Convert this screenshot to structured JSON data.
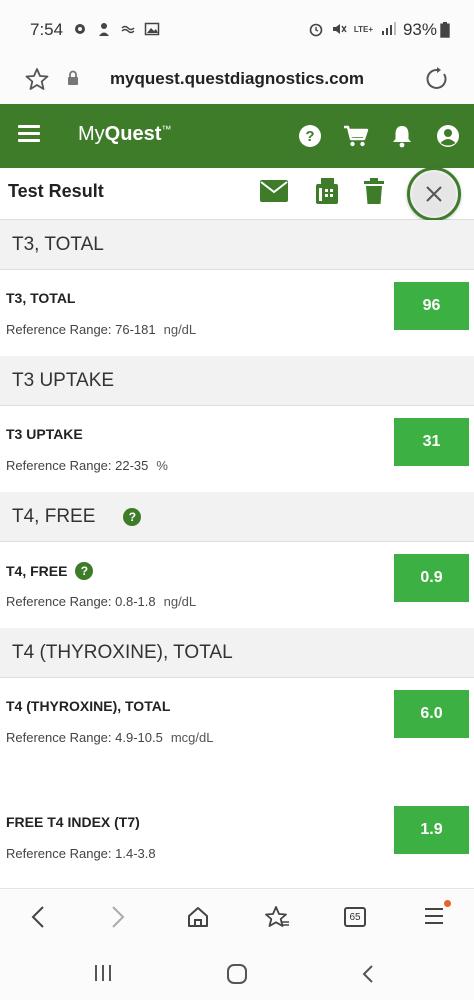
{
  "status": {
    "time": "7:54",
    "network": "LTE+",
    "battery": "93%"
  },
  "browser": {
    "url": "myquest.questdiagnostics.com",
    "tab_count": "65"
  },
  "app": {
    "logo_prefix": "My",
    "logo_bold": "Quest",
    "logo_tm": "™",
    "brand_color": "#3e7c2a",
    "value_color": "#3cb043"
  },
  "toolbar": {
    "title": "Test Result"
  },
  "results": [
    {
      "section": "T3, TOTAL",
      "name": "T3, TOTAL",
      "reference": "Reference Range: 76-181",
      "unit": "ng/dL",
      "value": "96",
      "help": false
    },
    {
      "section": "T3 UPTAKE",
      "name": "T3 UPTAKE",
      "reference": "Reference Range: 22-35",
      "unit": "%",
      "value": "31",
      "help": false
    },
    {
      "section": "T4, FREE",
      "name": "T4, FREE",
      "reference": "Reference Range: 0.8-1.8",
      "unit": "ng/dL",
      "value": "0.9",
      "help": true
    },
    {
      "section": "T4 (THYROXINE), TOTAL",
      "name": "T4 (THYROXINE), TOTAL",
      "reference": "Reference Range: 4.9-10.5",
      "unit": "mcg/dL",
      "value": "6.0",
      "help": false
    },
    {
      "name": "FREE T4 INDEX (T7)",
      "reference": "Reference Range: 1.4-3.8",
      "unit": "",
      "value": "1.9"
    }
  ]
}
